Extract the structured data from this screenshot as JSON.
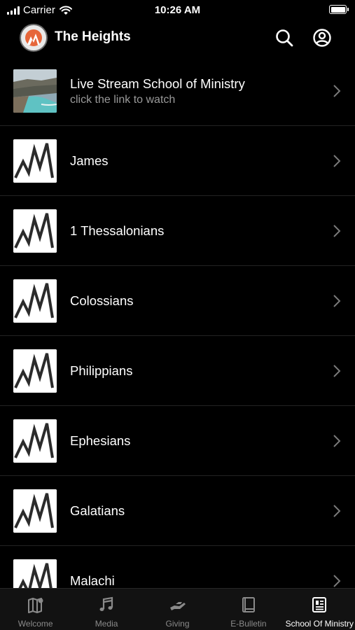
{
  "status_bar": {
    "carrier": "Carrier",
    "time": "10:26 AM"
  },
  "header": {
    "title": "The Heights"
  },
  "list": [
    {
      "title": "Live Stream School of Ministry",
      "subtitle": "click the link to watch"
    },
    {
      "title": "James"
    },
    {
      "title": "1 Thessalonians"
    },
    {
      "title": "Colossians"
    },
    {
      "title": "Philippians"
    },
    {
      "title": "Ephesians"
    },
    {
      "title": "Galatians"
    },
    {
      "title": "Malachi"
    }
  ],
  "tabs": [
    {
      "label": "Welcome",
      "icon": "map-icon",
      "active": false
    },
    {
      "label": "Media",
      "icon": "music-note-icon",
      "active": false
    },
    {
      "label": "Giving",
      "icon": "giving-hand-icon",
      "active": false
    },
    {
      "label": "E-Bulletin",
      "icon": "book-icon",
      "active": false
    },
    {
      "label": "School Of Ministry",
      "icon": "newspaper-icon",
      "active": true
    }
  ],
  "colors": {
    "background": "#000000",
    "tab_bar": "#121212",
    "subtitle": "#9a9a9a",
    "inactive_tab": "#8a8a8a",
    "active_tab": "#ffffff"
  }
}
